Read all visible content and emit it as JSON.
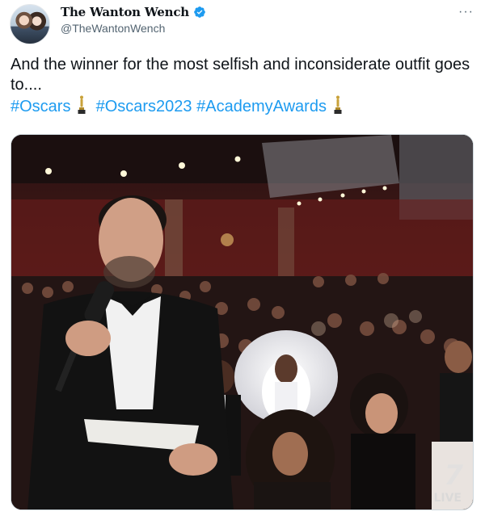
{
  "author": {
    "display_name": "The Wanton Wench",
    "handle": "@TheWantonWench",
    "verified_icon": "verified-badge-icon"
  },
  "menu": {
    "more_label": "···"
  },
  "tweet": {
    "line1": "And the winner for the most selfish and inconsiderate outfit goes to....",
    "hashtags": [
      "#Oscars",
      "#Oscars2023",
      "#AcademyAwards"
    ]
  },
  "media": {
    "watermark_number": "7",
    "watermark_text": "LIVE"
  },
  "colors": {
    "link": "#1d9bf0",
    "text": "#0f1419",
    "muted": "#536471",
    "verified": "#1d9bf0"
  }
}
